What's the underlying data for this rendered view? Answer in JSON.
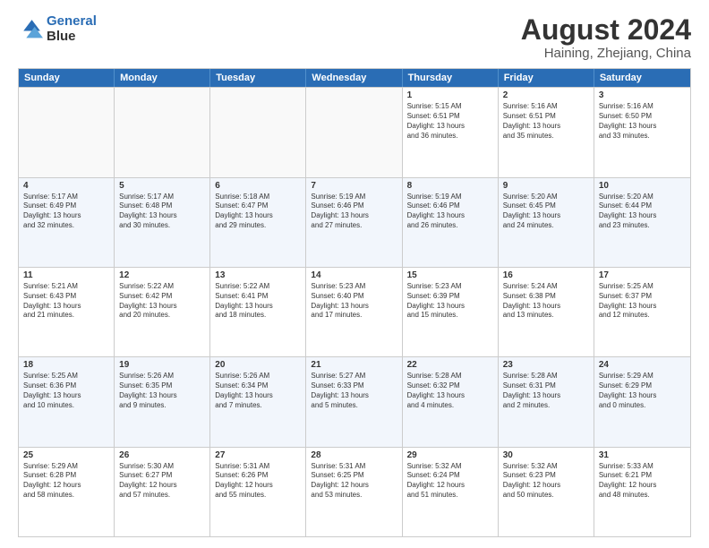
{
  "logo": {
    "line1": "General",
    "line2": "Blue"
  },
  "title": "August 2024",
  "subtitle": "Haining, Zhejiang, China",
  "days": [
    "Sunday",
    "Monday",
    "Tuesday",
    "Wednesday",
    "Thursday",
    "Friday",
    "Saturday"
  ],
  "rows": [
    [
      {
        "day": "",
        "info": ""
      },
      {
        "day": "",
        "info": ""
      },
      {
        "day": "",
        "info": ""
      },
      {
        "day": "",
        "info": ""
      },
      {
        "day": "1",
        "info": "Sunrise: 5:15 AM\nSunset: 6:51 PM\nDaylight: 13 hours\nand 36 minutes."
      },
      {
        "day": "2",
        "info": "Sunrise: 5:16 AM\nSunset: 6:51 PM\nDaylight: 13 hours\nand 35 minutes."
      },
      {
        "day": "3",
        "info": "Sunrise: 5:16 AM\nSunset: 6:50 PM\nDaylight: 13 hours\nand 33 minutes."
      }
    ],
    [
      {
        "day": "4",
        "info": "Sunrise: 5:17 AM\nSunset: 6:49 PM\nDaylight: 13 hours\nand 32 minutes."
      },
      {
        "day": "5",
        "info": "Sunrise: 5:17 AM\nSunset: 6:48 PM\nDaylight: 13 hours\nand 30 minutes."
      },
      {
        "day": "6",
        "info": "Sunrise: 5:18 AM\nSunset: 6:47 PM\nDaylight: 13 hours\nand 29 minutes."
      },
      {
        "day": "7",
        "info": "Sunrise: 5:19 AM\nSunset: 6:46 PM\nDaylight: 13 hours\nand 27 minutes."
      },
      {
        "day": "8",
        "info": "Sunrise: 5:19 AM\nSunset: 6:46 PM\nDaylight: 13 hours\nand 26 minutes."
      },
      {
        "day": "9",
        "info": "Sunrise: 5:20 AM\nSunset: 6:45 PM\nDaylight: 13 hours\nand 24 minutes."
      },
      {
        "day": "10",
        "info": "Sunrise: 5:20 AM\nSunset: 6:44 PM\nDaylight: 13 hours\nand 23 minutes."
      }
    ],
    [
      {
        "day": "11",
        "info": "Sunrise: 5:21 AM\nSunset: 6:43 PM\nDaylight: 13 hours\nand 21 minutes."
      },
      {
        "day": "12",
        "info": "Sunrise: 5:22 AM\nSunset: 6:42 PM\nDaylight: 13 hours\nand 20 minutes."
      },
      {
        "day": "13",
        "info": "Sunrise: 5:22 AM\nSunset: 6:41 PM\nDaylight: 13 hours\nand 18 minutes."
      },
      {
        "day": "14",
        "info": "Sunrise: 5:23 AM\nSunset: 6:40 PM\nDaylight: 13 hours\nand 17 minutes."
      },
      {
        "day": "15",
        "info": "Sunrise: 5:23 AM\nSunset: 6:39 PM\nDaylight: 13 hours\nand 15 minutes."
      },
      {
        "day": "16",
        "info": "Sunrise: 5:24 AM\nSunset: 6:38 PM\nDaylight: 13 hours\nand 13 minutes."
      },
      {
        "day": "17",
        "info": "Sunrise: 5:25 AM\nSunset: 6:37 PM\nDaylight: 13 hours\nand 12 minutes."
      }
    ],
    [
      {
        "day": "18",
        "info": "Sunrise: 5:25 AM\nSunset: 6:36 PM\nDaylight: 13 hours\nand 10 minutes."
      },
      {
        "day": "19",
        "info": "Sunrise: 5:26 AM\nSunset: 6:35 PM\nDaylight: 13 hours\nand 9 minutes."
      },
      {
        "day": "20",
        "info": "Sunrise: 5:26 AM\nSunset: 6:34 PM\nDaylight: 13 hours\nand 7 minutes."
      },
      {
        "day": "21",
        "info": "Sunrise: 5:27 AM\nSunset: 6:33 PM\nDaylight: 13 hours\nand 5 minutes."
      },
      {
        "day": "22",
        "info": "Sunrise: 5:28 AM\nSunset: 6:32 PM\nDaylight: 13 hours\nand 4 minutes."
      },
      {
        "day": "23",
        "info": "Sunrise: 5:28 AM\nSunset: 6:31 PM\nDaylight: 13 hours\nand 2 minutes."
      },
      {
        "day": "24",
        "info": "Sunrise: 5:29 AM\nSunset: 6:29 PM\nDaylight: 13 hours\nand 0 minutes."
      }
    ],
    [
      {
        "day": "25",
        "info": "Sunrise: 5:29 AM\nSunset: 6:28 PM\nDaylight: 12 hours\nand 58 minutes."
      },
      {
        "day": "26",
        "info": "Sunrise: 5:30 AM\nSunset: 6:27 PM\nDaylight: 12 hours\nand 57 minutes."
      },
      {
        "day": "27",
        "info": "Sunrise: 5:31 AM\nSunset: 6:26 PM\nDaylight: 12 hours\nand 55 minutes."
      },
      {
        "day": "28",
        "info": "Sunrise: 5:31 AM\nSunset: 6:25 PM\nDaylight: 12 hours\nand 53 minutes."
      },
      {
        "day": "29",
        "info": "Sunrise: 5:32 AM\nSunset: 6:24 PM\nDaylight: 12 hours\nand 51 minutes."
      },
      {
        "day": "30",
        "info": "Sunrise: 5:32 AM\nSunset: 6:23 PM\nDaylight: 12 hours\nand 50 minutes."
      },
      {
        "day": "31",
        "info": "Sunrise: 5:33 AM\nSunset: 6:21 PM\nDaylight: 12 hours\nand 48 minutes."
      }
    ]
  ]
}
